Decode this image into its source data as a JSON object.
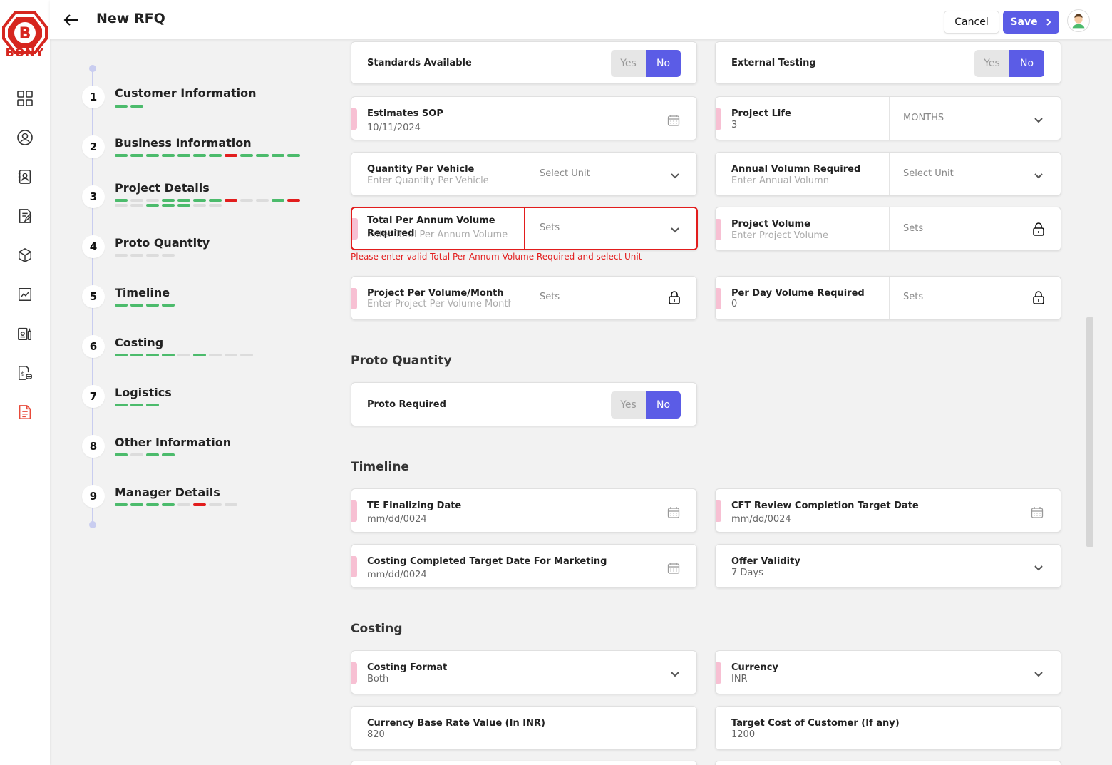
{
  "brand": {
    "name": "BONY",
    "accent": "#d6261f"
  },
  "header": {
    "title": "New RFQ",
    "cancel_label": "Cancel",
    "save_label": "Save"
  },
  "nav_icons": [
    "grid-icon",
    "user-circle-icon",
    "contacts-icon",
    "document-edit-icon",
    "cube-icon",
    "chart-icon",
    "toolbox-icon",
    "invoice-icon",
    "report-icon"
  ],
  "steps": [
    {
      "num": "1",
      "label": "Customer Information",
      "bars": "gg"
    },
    {
      "num": "2",
      "label": "Business Information",
      "bars": "gggggggrgggg"
    },
    {
      "num": "3",
      "label": "Project Details",
      "bars": "gnnggggrnngrnngggnn"
    },
    {
      "num": "4",
      "label": "Proto Quantity",
      "bars": "nnnn"
    },
    {
      "num": "5",
      "label": "Timeline",
      "bars": "gggg"
    },
    {
      "num": "6",
      "label": "Costing",
      "bars": "ggggngnnn"
    },
    {
      "num": "7",
      "label": "Logistics",
      "bars": "ggg"
    },
    {
      "num": "8",
      "label": "Other Information",
      "bars": "gngg"
    },
    {
      "num": "9",
      "label": "Manager Details",
      "bars": "ggggnrnn"
    }
  ],
  "toggle": {
    "yes": "Yes",
    "no": "No"
  },
  "fields": {
    "standards_available": "Standards Available",
    "external_testing": "External Testing",
    "estimates_sop": {
      "label": "Estimates SOP",
      "value": "10/11/2024"
    },
    "project_life": {
      "label": "Project Life",
      "value": "3",
      "unit": "MONTHS"
    },
    "qty_per_vehicle": {
      "label": "Quantity Per Vehicle",
      "placeholder": "Enter Quantity Per Vehicle",
      "unit": "Select Unit"
    },
    "annual_volume": {
      "label": "Annual Volumn Required",
      "placeholder": "Enter Annual Volumn",
      "unit": "Select Unit"
    },
    "total_per_annum": {
      "label": "Total Per Annum Volume Required",
      "placeholder": "Enter Total Per Annum Volume",
      "unit": "Sets"
    },
    "total_per_annum_error": "Please enter valid Total Per Annum Volume Required and select Unit",
    "project_volume": {
      "label": "Project Volume",
      "placeholder": "Enter Project Volume",
      "unit": "Sets"
    },
    "project_per_month": {
      "label": "Project Per Volume/Month",
      "placeholder": "Enter Project Per Volume Month",
      "unit": "Sets"
    },
    "per_day_volume": {
      "label": "Per Day Volume Required",
      "value": "0",
      "unit": "Sets"
    },
    "proto_required": "Proto Required",
    "te_finalizing": {
      "label": "TE Finalizing Date",
      "value": "mm/dd/0024"
    },
    "cft_review": {
      "label": "CFT Review Completion Target Date",
      "value": "mm/dd/0024"
    },
    "costing_completed": {
      "label": "Costing Completed Target Date For Marketing",
      "value": "mm/dd/0024"
    },
    "offer_validity": {
      "label": "Offer Validity",
      "value": "7 Days"
    },
    "costing_format": {
      "label": "Costing Format",
      "value": "Both"
    },
    "currency": {
      "label": "Currency",
      "value": "INR"
    },
    "currency_base_rate": {
      "label": "Currency Base Rate Value (In INR)",
      "value": "820"
    },
    "target_cost": {
      "label": "Target Cost of Customer (If any)",
      "value": "1200"
    }
  },
  "sections": {
    "proto": "Proto Quantity",
    "timeline": "Timeline",
    "costing": "Costing"
  }
}
